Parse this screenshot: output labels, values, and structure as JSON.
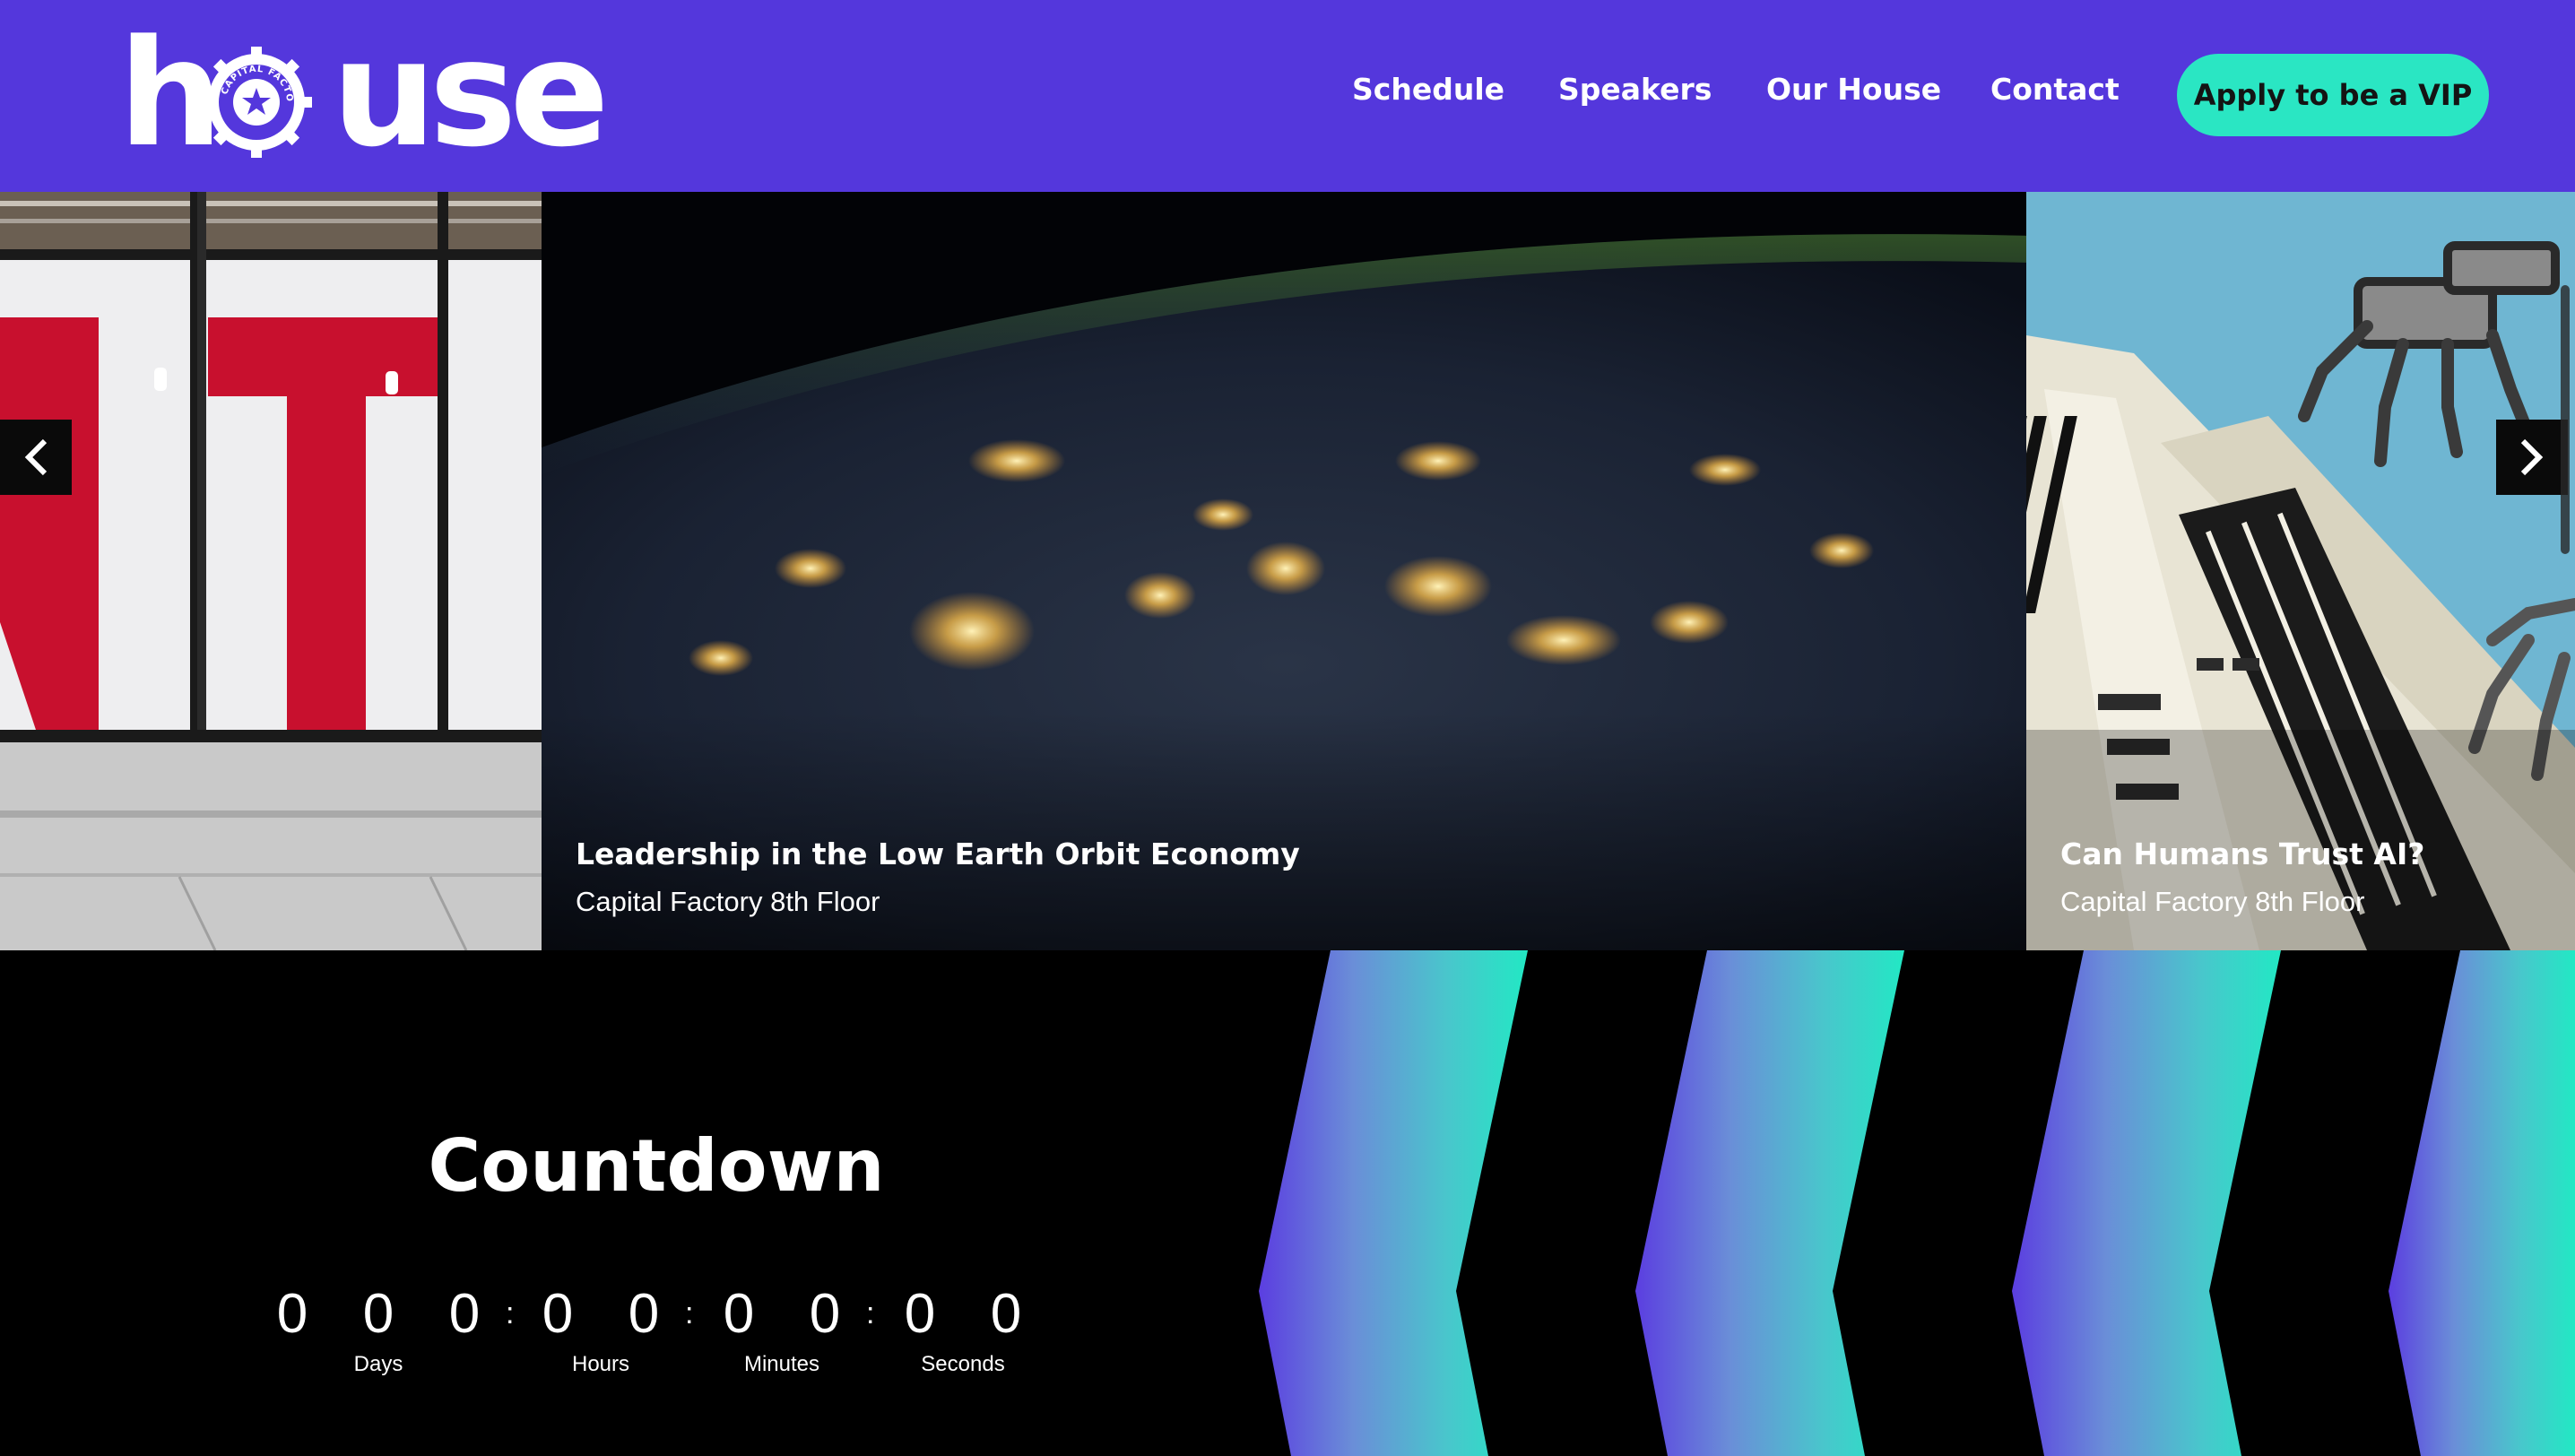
{
  "brand": {
    "logo_text_h": "h",
    "logo_text_use": "use",
    "gear_text": "CAPITAL FACTORY",
    "header_color": "#5437dc",
    "accent_color": "#2ae6c3"
  },
  "nav": {
    "items": [
      {
        "label": "Schedule"
      },
      {
        "label": "Speakers"
      },
      {
        "label": "Our House"
      },
      {
        "label": "Contact"
      }
    ],
    "cta_label": "Apply to be a VIP"
  },
  "carousel": {
    "slides": [
      {
        "title": "",
        "subtitle": "",
        "image": "capital-factory-sign-photo"
      },
      {
        "title": "Leadership in the Low Earth Orbit Economy",
        "subtitle": "Capital Factory 8th Floor",
        "image": "earth-at-night-photo"
      },
      {
        "title": "Can Humans Trust AI?",
        "subtitle": "Capital Factory 8th Floor",
        "image": "robot-hands-piano-photo"
      }
    ],
    "prev_icon": "chevron-left-icon",
    "next_icon": "chevron-right-icon"
  },
  "countdown": {
    "title": "Countdown",
    "digits": {
      "days": [
        "0",
        "0",
        "0"
      ],
      "hours": [
        "0",
        "0"
      ],
      "minutes": [
        "0",
        "0"
      ],
      "seconds": [
        "0",
        "0"
      ]
    },
    "separator": ":",
    "labels": {
      "days": "Days",
      "hours": "Hours",
      "minutes": "Minutes",
      "seconds": "Seconds"
    }
  },
  "decor": {
    "chevron_colors": [
      "#5b3ee0",
      "#6a8ed8",
      "#49c6cc",
      "#22e8c4"
    ]
  }
}
